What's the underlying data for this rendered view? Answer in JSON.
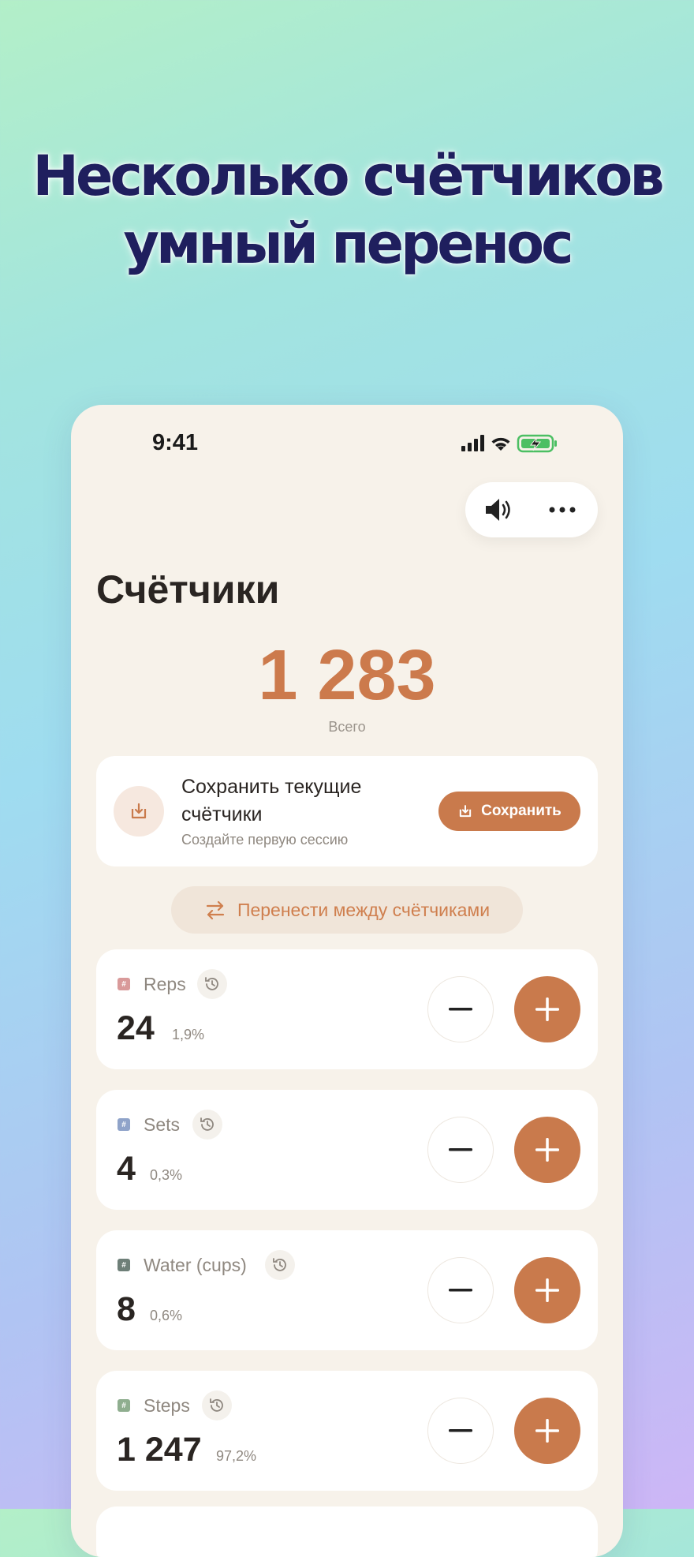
{
  "headline": {
    "line1": "Несколько счётчиков",
    "line2": "умный перенос"
  },
  "status_bar": {
    "time": "9:41"
  },
  "screen": {
    "title": "Счётчики",
    "total": "1 283",
    "total_label": "Всего"
  },
  "save_card": {
    "title": "Сохранить текущие счётчики",
    "subtitle": "Создайте первую сессию",
    "button_label": "Сохранить"
  },
  "transfer_button": {
    "label": "Перенести между счётчиками"
  },
  "counters": [
    {
      "name": "Reps",
      "value": "24",
      "percent": "1,9%",
      "tag_color": "#d99a9a"
    },
    {
      "name": "Sets",
      "value": "4",
      "percent": "0,3%",
      "tag_color": "#8fa3c9"
    },
    {
      "name": "Water (cups)",
      "value": "8",
      "percent": "0,6%",
      "tag_color": "#6e7f78"
    },
    {
      "name": "Steps",
      "value": "1 247",
      "percent": "97,2%",
      "tag_color": "#8fae8f"
    }
  ],
  "colors": {
    "accent": "#c97a4c",
    "headline": "#1f1f5e",
    "card_background": "#ffffff",
    "screen_background": "#f7f2ea"
  }
}
